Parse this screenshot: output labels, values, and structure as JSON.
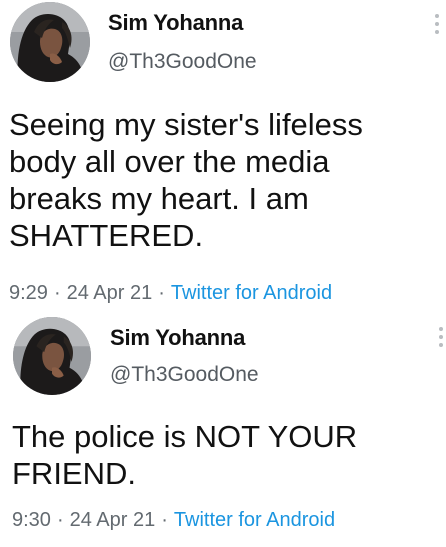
{
  "tweets": [
    {
      "display_name": "Sim Yohanna",
      "handle": "@Th3GoodOne",
      "text_lines": [
        "Seeing my sister's lifeless",
        "body all over the media",
        "breaks my heart. I am",
        "SHATTERED."
      ],
      "time": "9:29",
      "date": "24 Apr 21",
      "source": "Twitter for Android",
      "separator": "·",
      "icons": {
        "avatar": "profile-photo",
        "menu": "more-vertical-icon"
      }
    },
    {
      "display_name": "Sim Yohanna",
      "handle": "@Th3GoodOne",
      "text_lines": [
        "The police is NOT YOUR",
        "FRIEND."
      ],
      "time": "9:30",
      "date": "24 Apr 21",
      "source": "Twitter for Android",
      "separator": "·",
      "icons": {
        "avatar": "profile-photo",
        "menu": "more-vertical-icon"
      }
    }
  ],
  "colors": {
    "text": "#111111",
    "handle": "#555b61",
    "meta": "#636a70",
    "link": "#1b95e0",
    "menu_dots": "#b9bdc1"
  }
}
